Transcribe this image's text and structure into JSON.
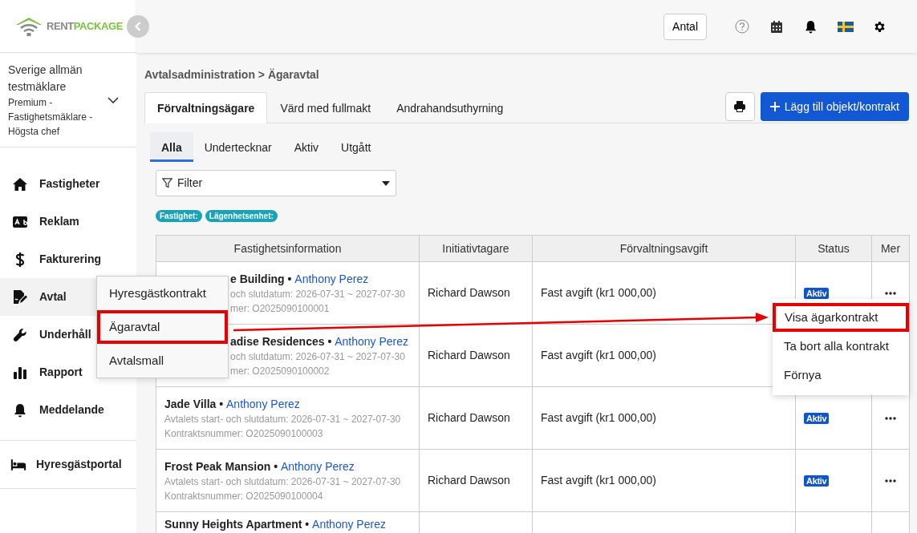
{
  "brand": {
    "first": "RENT",
    "second": "PACKAGE"
  },
  "account": {
    "name": "Sverige allmän testmäklare",
    "role": "Premium - Fastighetsmäklare - Högsta chef"
  },
  "sidebar": {
    "items": [
      {
        "label": "Fastigheter",
        "selected": false
      },
      {
        "label": "Reklam",
        "selected": false
      },
      {
        "label": "Fakturering",
        "selected": false
      },
      {
        "label": "Avtal",
        "selected": true
      },
      {
        "label": "Underhåll",
        "selected": false
      },
      {
        "label": "Rapport",
        "selected": false
      },
      {
        "label": "Meddelande",
        "selected": false
      }
    ],
    "portal": {
      "label": "Hyresgästportal"
    }
  },
  "flyout": {
    "items": [
      {
        "label": "Hyresgästkontrakt",
        "highlighted": false
      },
      {
        "label": "Ägaravtal",
        "highlighted": true
      },
      {
        "label": "Avtalsmall",
        "highlighted": false
      }
    ]
  },
  "header": {
    "count_button": "Antal"
  },
  "breadcrumb": "Avtalsadministration > Ägaravtal",
  "tabs": [
    {
      "label": "Förvaltningsägare",
      "selected": true
    },
    {
      "label": "Värd med fullmakt",
      "selected": false
    },
    {
      "label": "Andrahandsuthyrning",
      "selected": false
    }
  ],
  "add_button": "Lägg till objekt/kontrakt",
  "subtabs": [
    {
      "label": "Alla",
      "selected": true
    },
    {
      "label": "Undertecknar",
      "selected": false
    },
    {
      "label": "Aktiv",
      "selected": false
    },
    {
      "label": "Utgått",
      "selected": false
    }
  ],
  "filter": {
    "value": "Filter"
  },
  "tags": [
    "Fastighet:",
    "Lägenhetsenhet:"
  ],
  "table": {
    "columns": [
      "Fastighetsinformation",
      "Initiativtagare",
      "Förvaltningsavgift",
      "Status",
      "Mer"
    ],
    "rows": [
      {
        "property": "e Building •",
        "owner": "Anthony Perez",
        "dates": "och slutdatum: 2026-07-31 ~ 2027-07-30",
        "contract": "mer: O2025090100001",
        "initiator": "Richard Dawson",
        "fee": "Fast avgift (kr1 000,00)",
        "status": "Aktiv",
        "more": true
      },
      {
        "property": "adise Residences •",
        "owner": "Anthony Perez",
        "dates": "och slutdatum: 2026-07-31 ~ 2027-07-30",
        "contract": "mer: O2025090100002",
        "initiator": "Richard Dawson",
        "fee": "Fast avgift (kr1 000,00)",
        "more": false
      },
      {
        "property": "Jade Villa •",
        "owner": "Anthony Perez",
        "dates": "Avtalets start- och slutdatum: 2026-07-31 ~ 2027-07-30",
        "contract": "Kontraktsnummer: O2025090100003",
        "initiator": "Richard Dawson",
        "fee": "Fast avgift (kr1 000,00)",
        "status": "Aktiv",
        "more": true
      },
      {
        "property": "Frost Peak Mansion •",
        "owner": "Anthony Perez",
        "dates": "Avtalets start- och slutdatum: 2026-07-31 ~ 2027-07-30",
        "contract": "Kontraktsnummer: O2025090100004",
        "initiator": "Richard Dawson",
        "fee": "Fast avgift (kr1 000,00)",
        "status": "Aktiv",
        "more": true
      },
      {
        "property": "Sunny Heights Apartment •",
        "owner": "Anthony Perez",
        "more": false
      }
    ]
  },
  "row_menu": {
    "items": [
      {
        "label": "Visa ägarkontrakt",
        "highlighted": true
      },
      {
        "label": "Ta bort alla kontrakt",
        "highlighted": false
      },
      {
        "label": "Förnya",
        "highlighted": false
      }
    ]
  },
  "callout_arrow": true
}
